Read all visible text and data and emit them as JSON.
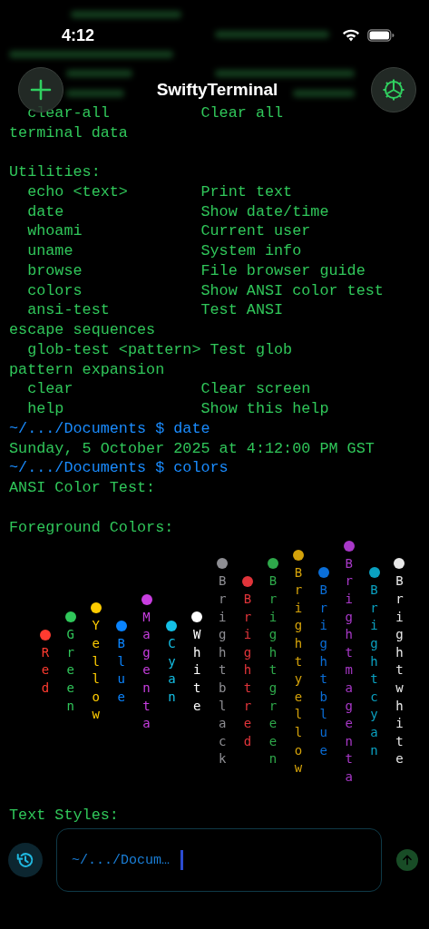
{
  "status_bar": {
    "time": "4:12"
  },
  "nav": {
    "title": "SwiftyTerminal"
  },
  "terminal": {
    "lines": [
      {
        "kind": "blurred"
      },
      {
        "kind": "row",
        "cmd": "clear-all",
        "desc": "Clear all"
      },
      {
        "kind": "text",
        "text": "terminal data"
      },
      {
        "kind": "blank"
      },
      {
        "kind": "text",
        "text": "Utilities:"
      },
      {
        "kind": "row",
        "cmd": "echo <text>",
        "desc": "Print text"
      },
      {
        "kind": "row",
        "cmd": "date",
        "desc": "Show date/time"
      },
      {
        "kind": "row",
        "cmd": "whoami",
        "desc": "Current user"
      },
      {
        "kind": "row",
        "cmd": "uname",
        "desc": "System info"
      },
      {
        "kind": "row",
        "cmd": "browse",
        "desc": "File browser guide"
      },
      {
        "kind": "row",
        "cmd": "colors",
        "desc": "Show ANSI color test"
      },
      {
        "kind": "row",
        "cmd": "ansi-test",
        "desc": "Test ANSI"
      },
      {
        "kind": "text",
        "text": "escape sequences"
      },
      {
        "kind": "row",
        "cmd": "glob-test <pattern>",
        "desc": "Test glob"
      },
      {
        "kind": "text",
        "text": "pattern expansion"
      },
      {
        "kind": "row",
        "cmd": "clear",
        "desc": "Clear screen"
      },
      {
        "kind": "row",
        "cmd": "help",
        "desc": "Show this help"
      },
      {
        "kind": "prompt",
        "text": "~/.../Documents $ date"
      },
      {
        "kind": "text",
        "text": "Sunday, 5 October 2025 at 4:12:00 PM GST"
      },
      {
        "kind": "prompt",
        "text": "~/.../Documents $ colors"
      },
      {
        "kind": "text",
        "text": "ANSI Color Test:"
      },
      {
        "kind": "blank"
      },
      {
        "kind": "text",
        "text": "Foreground Colors:"
      }
    ],
    "color_samples": [
      {
        "label": "Red",
        "color": "#ff3b30"
      },
      {
        "label": "Green",
        "color": "#30c75a"
      },
      {
        "label": "Yellow",
        "color": "#ffcc00"
      },
      {
        "label": "Blue",
        "color": "#0a84ff"
      },
      {
        "label": "Magenta",
        "color": "#c83ee0"
      },
      {
        "label": "Cyan",
        "color": "#14c0e6"
      },
      {
        "label": "White",
        "color": "#ffffff"
      },
      {
        "label": "Brightblack",
        "color": "#8e8e93"
      },
      {
        "label": "Brightred",
        "color": "#e0343a"
      },
      {
        "label": "Brightgreen",
        "color": "#2ea84a"
      },
      {
        "label": "Brightyellow",
        "color": "#d4a20a"
      },
      {
        "label": "Brightblue",
        "color": "#0a6ed8"
      },
      {
        "label": "Brightmagenta",
        "color": "#a838c8"
      },
      {
        "label": "Brightcyan",
        "color": "#0aa0c0"
      },
      {
        "label": "Brightwhite",
        "color": "#e8e8e8"
      }
    ],
    "after": [
      {
        "kind": "text",
        "text": "Text Styles:"
      }
    ]
  },
  "input": {
    "value": "~/.../Docum…"
  }
}
